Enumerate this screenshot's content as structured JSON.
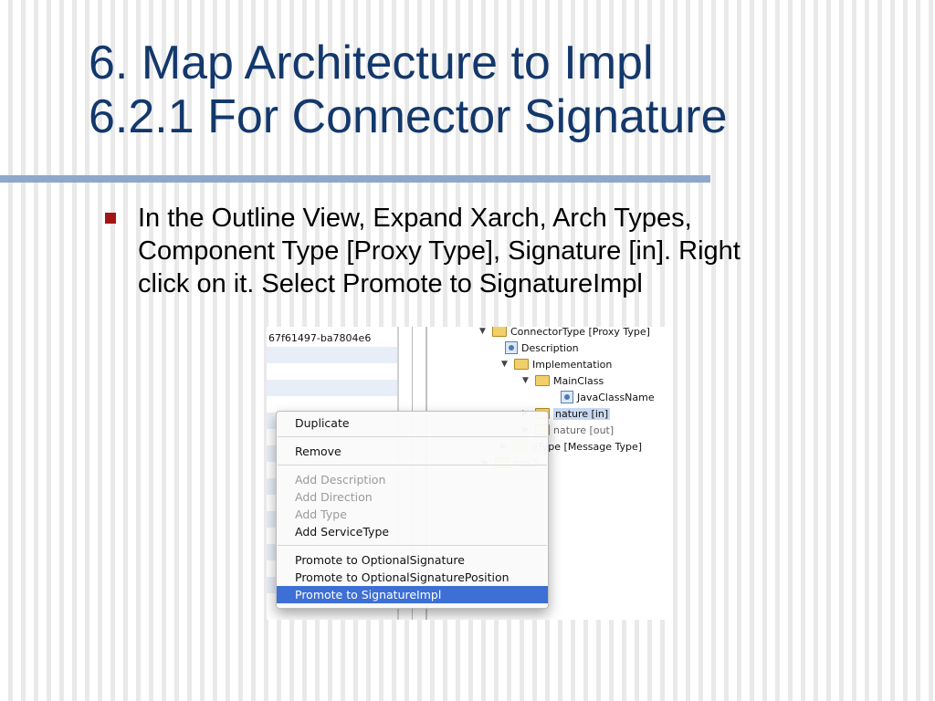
{
  "slide": {
    "title_lines": [
      "6. Map Architecture to Impl",
      "6.2.1 For Connector Signature"
    ],
    "bullet": "In the Outline View, Expand Xarch, Arch Types,\nComponent Type [Proxy Type], Signature [in]. Right\nclick on it. Select Promote to SignatureImpl",
    "colors": {
      "title": "#13386c",
      "rule": "#8ea8c9",
      "bullet_mark": "#a31515",
      "menu_highlight": "#3d6fd4"
    }
  },
  "screenshot": {
    "left_pane_id": "67f61497-ba7804e6",
    "tree": [
      {
        "label": "ConnectorType [Proxy Type]",
        "icon": "folder-open-icon",
        "twisty": "▼"
      },
      {
        "label": "Description",
        "icon": "element-icon",
        "twisty": ""
      },
      {
        "label": "Implementation",
        "icon": "folder-open-icon",
        "twisty": "▼"
      },
      {
        "label": "MainClass",
        "icon": "folder-open-icon",
        "twisty": "▼"
      },
      {
        "label": "JavaClassName",
        "icon": "element-icon",
        "twisty": ""
      },
      {
        "label": "nature [in]",
        "icon": "folder-icon",
        "twisty": "▶"
      },
      {
        "label": "nature [out]",
        "icon": "folder-icon",
        "twisty": "▶"
      },
      {
        "label": "eType [Message Type]",
        "icon": "folder-icon",
        "twisty": "▶"
      },
      {
        "label": "ints3",
        "icon": "folder-icon",
        "twisty": "▶"
      }
    ],
    "context_menu": {
      "duplicate": "Duplicate",
      "remove": "Remove",
      "add_description": "Add Description",
      "add_direction": "Add Direction",
      "add_type": "Add Type",
      "add_service_type": "Add ServiceType",
      "promote_optional_signature": "Promote to OptionalSignature",
      "promote_optional_signature_position": "Promote to OptionalSignaturePosition",
      "promote_signature_impl": "Promote to SignatureImpl"
    }
  }
}
